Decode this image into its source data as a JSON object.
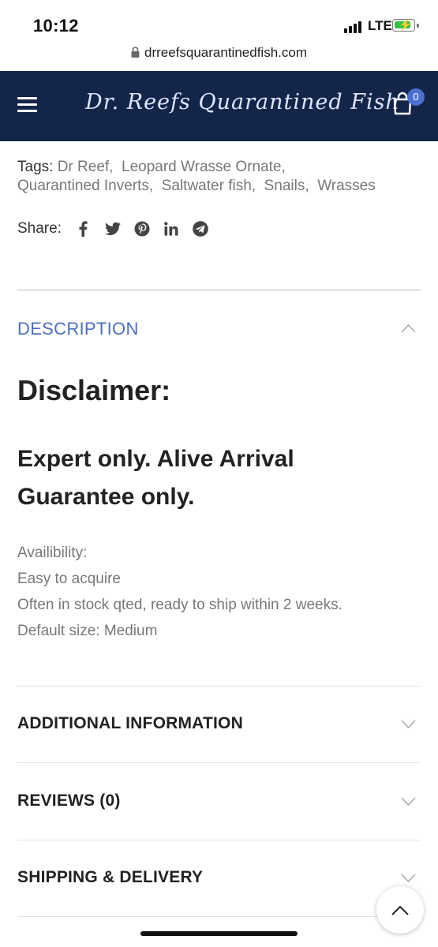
{
  "status_bar": {
    "time": "10:12",
    "network": "LTE"
  },
  "browser": {
    "url": "drreefsquarantinedfish.com"
  },
  "header": {
    "logo_text": "Dr. Reefs Quarantined Fish",
    "cart_count": "0"
  },
  "product_meta": {
    "tags_label": "Tags:",
    "tags": [
      "Dr Reef",
      "Leopard Wrasse Ornate",
      "Quarantined Inverts",
      "Saltwater fish",
      "Snails",
      "Wrasses"
    ],
    "share_label": "Share:",
    "share_icons": [
      "facebook-icon",
      "twitter-icon",
      "pinterest-icon",
      "linkedin-icon",
      "telegram-icon"
    ]
  },
  "description": {
    "tab_label": "DESCRIPTION",
    "heading": "Disclaimer:",
    "subheading": "Expert only. Alive Arrival Guarantee only.",
    "lines": [
      "Availibility:",
      "Easy to acquire",
      "Often in stock qted, ready to ship within 2 weeks.",
      "Default size: Medium"
    ]
  },
  "sections": {
    "additional": "ADDITIONAL INFORMATION",
    "reviews": "REVIEWS (0)",
    "shipping": "SHIPPING & DELIVERY"
  },
  "colors": {
    "header_bg": "#14254a",
    "accent": "#4d6fbd",
    "badge": "#4d6fd1"
  }
}
